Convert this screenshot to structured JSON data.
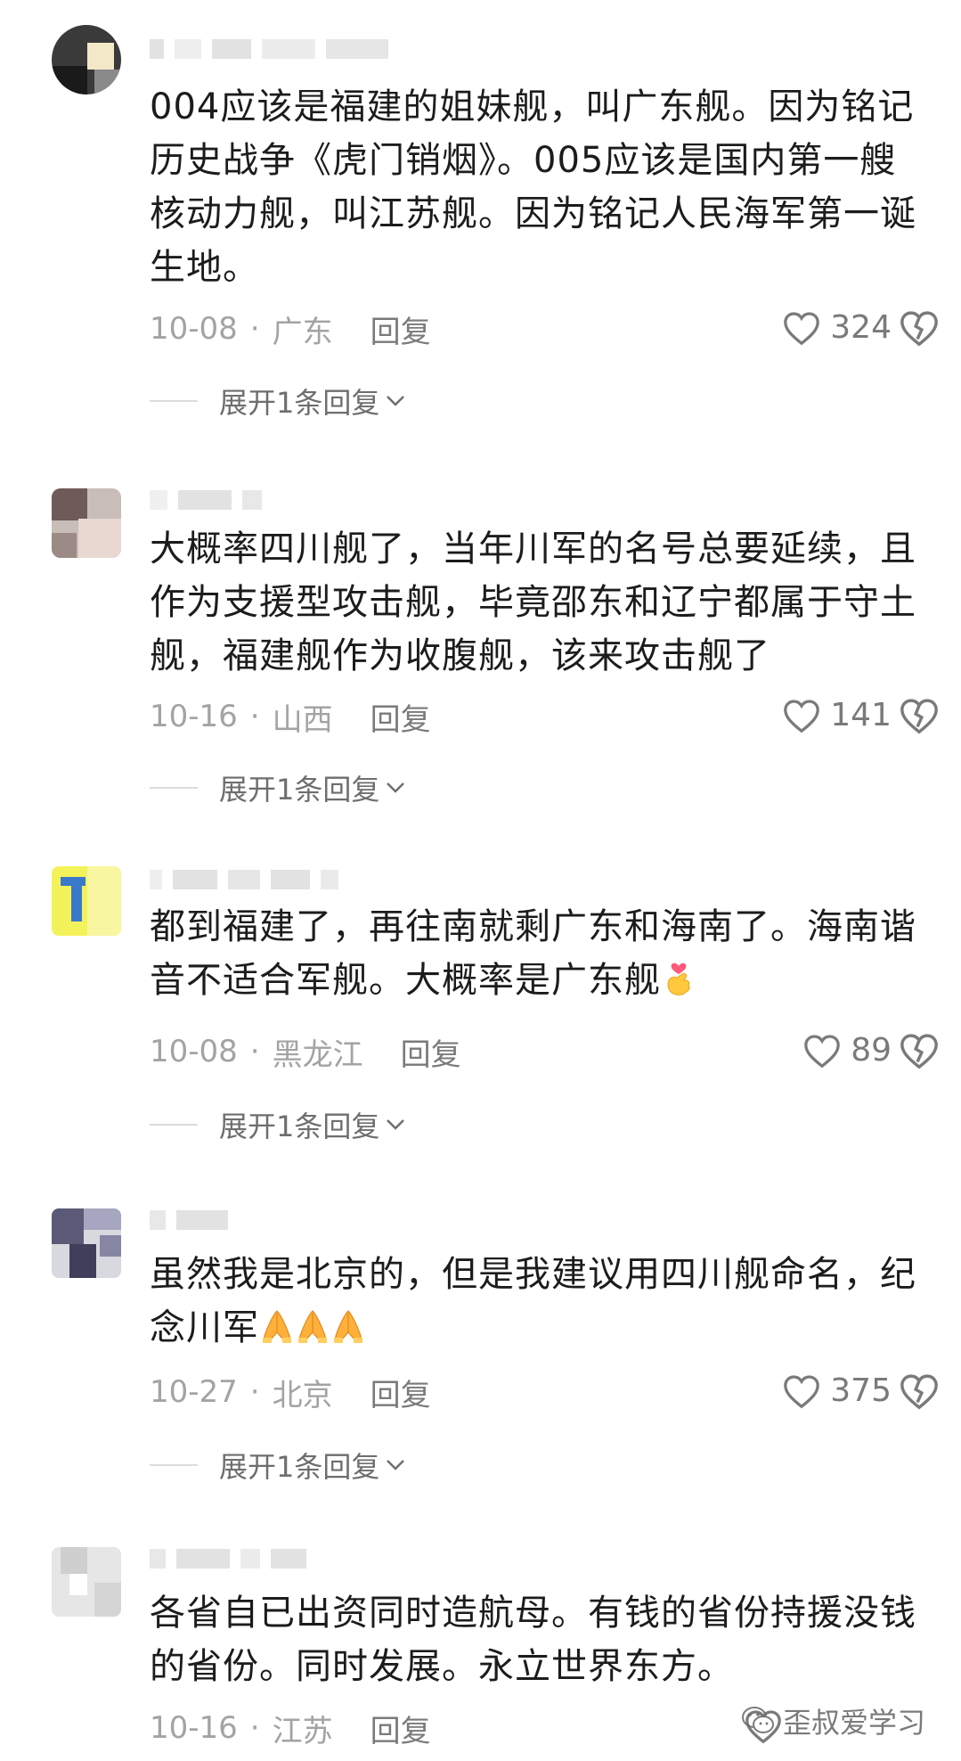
{
  "comments": [
    {
      "text": "004应该是福建的姐妹舰，叫广东舰。因为铭记历史战争《虎门销烟》。005应该是国内第一艘核动力舰，叫江苏舰。因为铭记人民海军第一诞生地。",
      "date": "10-08",
      "location": "广东",
      "reply_label": "回复",
      "likes": "324",
      "expand_label": "展开1条回复",
      "emoji": ""
    },
    {
      "text": "大概率四川舰了，当年川军的名号总要延续，且作为支援型攻击舰，毕竟邵东和辽宁都属于守土舰，福建舰作为收腹舰，该来攻击舰了",
      "date": "10-16",
      "location": "山西",
      "reply_label": "回复",
      "likes": "141",
      "expand_label": "展开1条回复",
      "emoji": ""
    },
    {
      "text": "都到福建了，再往南就剩广东和海南了。海南谐音不适合军舰。大概率是广东舰",
      "date": "10-08",
      "location": "黑龙江",
      "reply_label": "回复",
      "likes": "89",
      "expand_label": "展开1条回复",
      "emoji": "finger-heart"
    },
    {
      "text": "虽然我是北京的，但是我建议用四川舰命名，纪念川军",
      "date": "10-27",
      "location": "北京",
      "reply_label": "回复",
      "likes": "375",
      "expand_label": "展开1条回复",
      "emoji": "folded-hands x3"
    },
    {
      "text": "各省自已出资同时造航母。有钱的省份持援没钱的省份。同时发展。永立世界东方。",
      "date": "10-16",
      "location": "江苏",
      "reply_label": "回复",
      "likes": "",
      "expand_label": "",
      "emoji": ""
    }
  ],
  "meta_separator": "·",
  "watermark": {
    "text": "歪叔爱学习",
    "icon": "wechat-icon"
  },
  "icons": {
    "like": "heart-outline-icon",
    "dislike": "broken-heart-icon",
    "expand": "chevron-down-icon"
  },
  "colors": {
    "text": "#1c1c1c",
    "meta": "#a3a3a3",
    "action": "#7a7a7a"
  }
}
